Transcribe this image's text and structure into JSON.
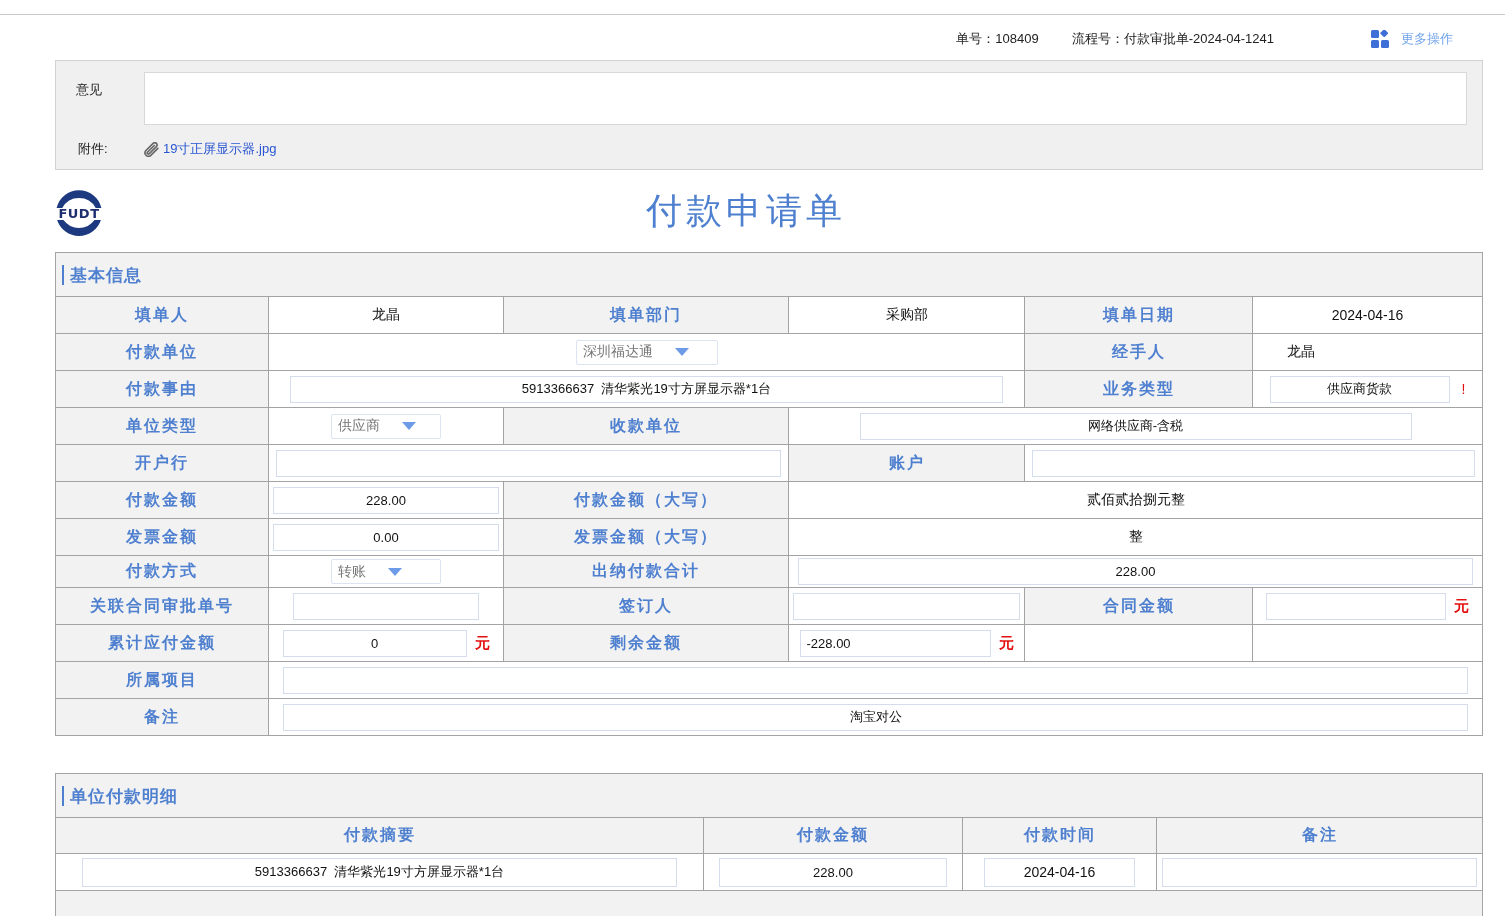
{
  "header": {
    "order_no": "单号：108409",
    "flow_no": "流程号：付款审批单-2024-04-1241",
    "more_actions": "更多操作"
  },
  "opinion": {
    "label": "意见",
    "attachment_label": "附件:",
    "attachment_name": "19寸正屏显示器.jpg"
  },
  "logo": {
    "text": "FUDT"
  },
  "form_title": "付款申请单",
  "basic_info": {
    "title": "基本信息",
    "rows": [
      [
        {
          "kind": "label",
          "text": "填单人"
        },
        {
          "kind": "text",
          "text": "龙晶"
        },
        {
          "kind": "label",
          "text": "填单部门"
        },
        {
          "kind": "text",
          "text": "采购部"
        },
        {
          "kind": "label",
          "text": "填单日期"
        },
        {
          "kind": "text",
          "text": "2024-04-16"
        }
      ],
      [
        {
          "kind": "label",
          "text": "付款单位"
        },
        {
          "kind": "select",
          "value": "深圳福达通",
          "colspan": 3
        },
        {
          "kind": "label",
          "text": "经手人"
        },
        {
          "kind": "text",
          "text": "龙晶"
        }
      ],
      [
        {
          "kind": "label",
          "text": "付款事由"
        },
        {
          "kind": "input",
          "value": "5913366637  清华紫光19寸方屏显示器*1台",
          "colspan": 3
        },
        {
          "kind": "label",
          "text": "业务类型"
        },
        {
          "kind": "input",
          "value": "供应商货款",
          "required_mark": "!"
        }
      ],
      [
        {
          "kind": "label",
          "text": "单位类型"
        },
        {
          "kind": "select",
          "value": "供应商"
        },
        {
          "kind": "label",
          "text": "收款单位"
        },
        {
          "kind": "input",
          "value": "网络供应商-含税",
          "colspan": 3
        }
      ],
      [
        {
          "kind": "label",
          "text": "开户行"
        },
        {
          "kind": "input",
          "colspan": 2
        },
        {
          "kind": "label",
          "text": "账户"
        },
        {
          "kind": "input",
          "colspan": 2
        }
      ],
      [
        {
          "kind": "label",
          "text": "付款金额"
        },
        {
          "kind": "input",
          "value": "228.00"
        },
        {
          "kind": "label",
          "text": "付款金额（大写）"
        },
        {
          "kind": "text",
          "text": "贰佰贰拾捌元整",
          "colspan": 3
        }
      ],
      [
        {
          "kind": "label",
          "text": "发票金额"
        },
        {
          "kind": "input",
          "value": "0.00"
        },
        {
          "kind": "label",
          "text": "发票金额（大写）"
        },
        {
          "kind": "text",
          "text": "整",
          "colspan": 3
        }
      ],
      [
        {
          "kind": "label",
          "text": "付款方式"
        },
        {
          "kind": "select",
          "value": "转账"
        },
        {
          "kind": "label",
          "text": "出纳付款合计"
        },
        {
          "kind": "input",
          "value": "228.00",
          "colspan": 3
        }
      ],
      [
        {
          "kind": "label",
          "text": "关联合同审批单号"
        },
        {
          "kind": "input"
        },
        {
          "kind": "label",
          "text": "签订人"
        },
        {
          "kind": "input"
        },
        {
          "kind": "label",
          "text": "合同金额"
        },
        {
          "kind": "input",
          "unit": "元"
        }
      ],
      [
        {
          "kind": "label",
          "text": "累计应付金额"
        },
        {
          "kind": "input",
          "value": "0",
          "unit": "元"
        },
        {
          "kind": "label",
          "text": "剩余金额"
        },
        {
          "kind": "input",
          "value": "-228.00",
          "unit": "元"
        }
      ],
      [
        {
          "kind": "label",
          "text": "所属项目"
        },
        {
          "kind": "input",
          "colspan": 5
        }
      ],
      [
        {
          "kind": "label",
          "text": "备注"
        },
        {
          "kind": "input",
          "value": "淘宝对公",
          "colspan": 5
        }
      ]
    ]
  },
  "payment_details": {
    "title": "单位付款明细",
    "columns": [
      "付款摘要",
      "付款金额",
      "付款时间",
      "备注"
    ],
    "rows": [
      {
        "summary": "5913366637  清华紫光19寸方屏显示器*1台",
        "amount": "228.00",
        "time": "2024-04-16"
      }
    ]
  }
}
